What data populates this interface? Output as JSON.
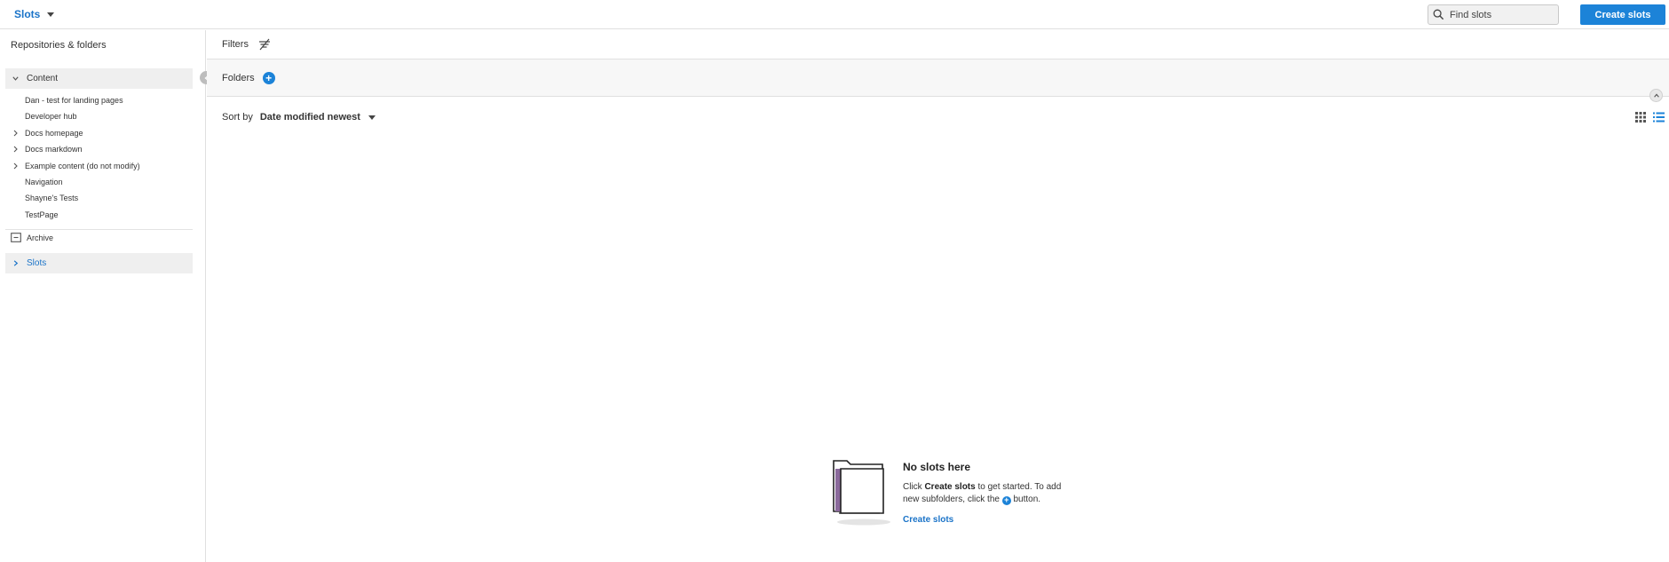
{
  "header": {
    "app_name": "Slots",
    "search_placeholder": "Find slots",
    "create_button": "Create slots"
  },
  "sidebar": {
    "title": "Repositories & folders",
    "content_label": "Content",
    "items": [
      {
        "label": "Dan - test for landing pages",
        "expandable": false
      },
      {
        "label": "Developer hub",
        "expandable": false
      },
      {
        "label": "Docs homepage",
        "expandable": true
      },
      {
        "label": "Docs markdown",
        "expandable": true
      },
      {
        "label": "Example content (do not modify)",
        "expandable": true
      },
      {
        "label": "Navigation",
        "expandable": false
      },
      {
        "label": "Shayne's Tests",
        "expandable": false
      },
      {
        "label": "TestPage",
        "expandable": false
      }
    ],
    "archive_label": "Archive",
    "slots_label": "Slots"
  },
  "main": {
    "filters_label": "Filters",
    "folders_label": "Folders",
    "sort_label": "Sort by",
    "sort_value": "Date modified newest"
  },
  "empty_state": {
    "title": "No slots here",
    "desc_prefix": "Click ",
    "desc_bold": "Create slots",
    "desc_mid": " to get started. To add new subfolders, click the ",
    "desc_suffix": " button.",
    "link": "Create slots"
  },
  "colors": {
    "accent": "#1c83d8",
    "link": "#1a73c8"
  }
}
